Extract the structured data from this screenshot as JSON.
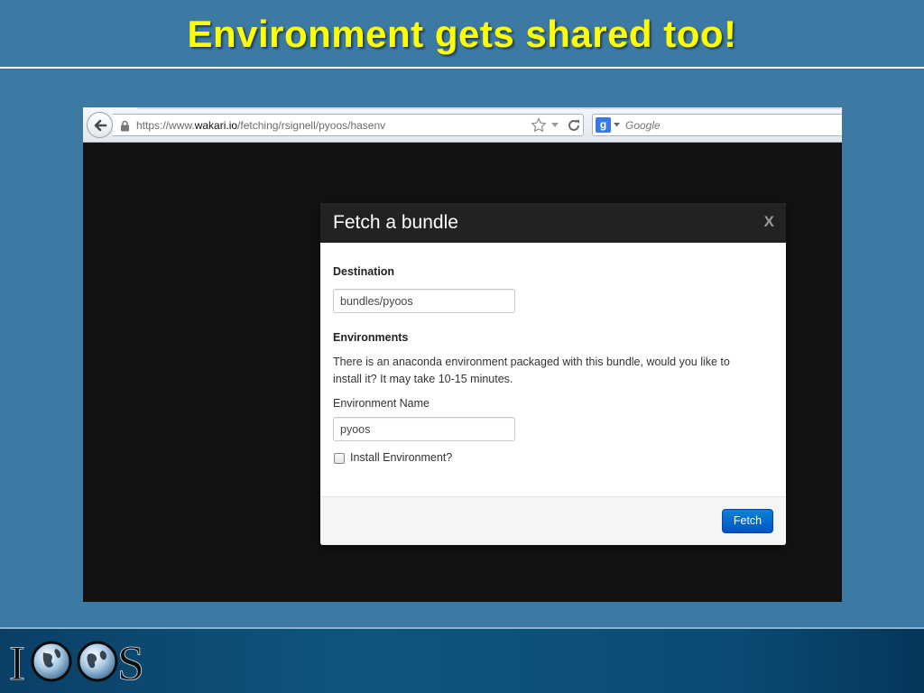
{
  "slide": {
    "title": "Environment gets shared too!"
  },
  "browser": {
    "url_prefix": "https://www.",
    "url_domain": "wakari.io",
    "url_path": "/fetching/rsignell/pyoos/hasenv",
    "search_engine_letter": "g",
    "search_placeholder": "Google",
    "icons": [
      "back-arrow-icon",
      "lock-icon",
      "star-icon",
      "dropdown-icon",
      "reload-icon",
      "google-icon"
    ]
  },
  "modal": {
    "title": "Fetch a bundle",
    "close_label": "X",
    "destination_label": "Destination",
    "destination_value": "bundles/pyoos",
    "environments_label": "Environments",
    "description_line1": "There is an anaconda environment packaged with this bundle, would you like to",
    "description_line2": "install it? It may take 10-15 minutes.",
    "env_name_label": "Environment Name",
    "env_name_value": "pyoos",
    "install_checkbox_label": "Install Environment?",
    "install_checked": false,
    "fetch_button": "Fetch"
  },
  "logo": {
    "text": "IOOS"
  },
  "colors": {
    "slide_bg": "#3d7aa3",
    "title": "#ffff00",
    "modal_header": "#222222",
    "primary_button": "#0a6fd1"
  }
}
